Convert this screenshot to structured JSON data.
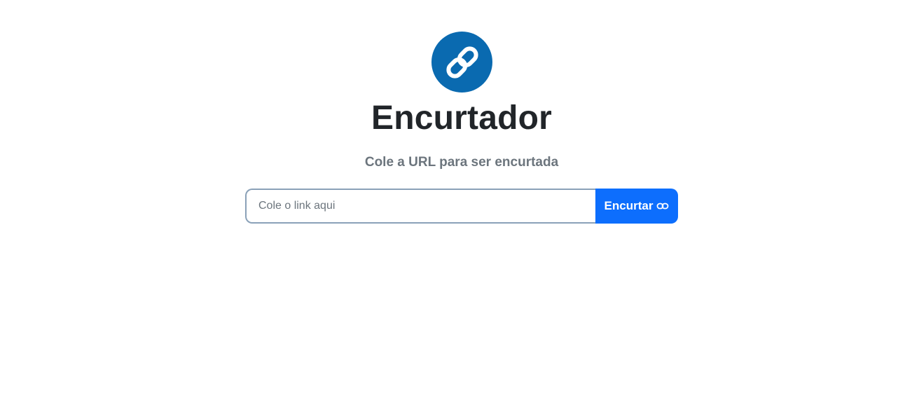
{
  "header": {
    "logo_icon": "chain-link-icon",
    "title": "Encurtador",
    "subtitle": "Cole a URL para ser encurtada"
  },
  "form": {
    "input_placeholder": "Cole o link aqui",
    "input_value": "",
    "button_label": "Encurtar",
    "button_icon": "link-icon"
  },
  "colors": {
    "logo_background": "#0a6ab0",
    "button_background": "#0d6efd",
    "input_border": "#8aa1b8",
    "title_text": "#212529",
    "subtitle_text": "#6c757d"
  }
}
